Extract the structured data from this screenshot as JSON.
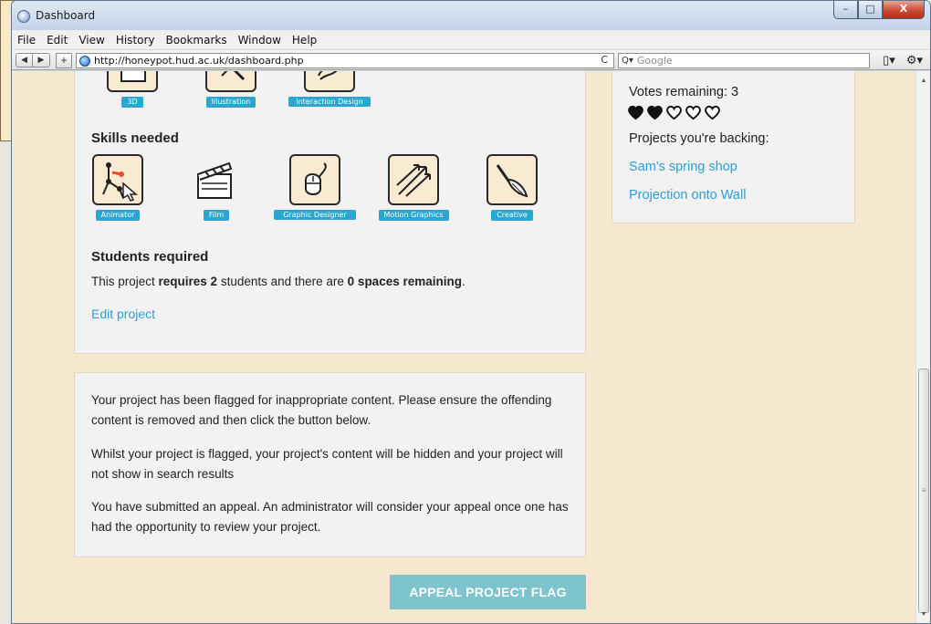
{
  "window": {
    "title": "Dashboard",
    "caption_buttons": {
      "minimize": "–",
      "maximize": "□",
      "close": "X"
    }
  },
  "menu": [
    "File",
    "Edit",
    "View",
    "History",
    "Bookmarks",
    "Window",
    "Help"
  ],
  "toolbar": {
    "back": "◀",
    "forward": "▶",
    "new_tab": "+",
    "url": "http://honeypot.hud.ac.uk/dashboard.php",
    "reload": "C",
    "search_prefix": "Q▾",
    "search_placeholder": "Google",
    "page_menu": "▯▾",
    "tools_menu": "⚙▾"
  },
  "categories": {
    "tiles": [
      {
        "label": "3D",
        "icon": "cube-icon"
      },
      {
        "label": "Illustration",
        "icon": "pencil-icon"
      },
      {
        "label": "Interaction Design",
        "icon": "interaction-icon"
      }
    ]
  },
  "skills": {
    "heading": "Skills needed",
    "tiles": [
      {
        "label": "Animator",
        "icon": "animator-icon"
      },
      {
        "label": "Film",
        "icon": "clapperboard-icon"
      },
      {
        "label": "Graphic Designer",
        "icon": "mouse-icon"
      },
      {
        "label": "Motion Graphics",
        "icon": "motion-arrows-icon"
      },
      {
        "label": "Creative",
        "icon": "paintbrush-icon"
      }
    ]
  },
  "students": {
    "heading": "Students required",
    "text_prefix": "This project ",
    "requires": "requires 2",
    "text_mid": " students and there are ",
    "spaces": "0 spaces remaining",
    "text_suffix": ".",
    "edit_link": "Edit project"
  },
  "flag_notice": {
    "para1": "Your project has been flagged for inappropriate content. Please ensure the offending content is removed and then click the button below.",
    "para2": "Whilst your project is flagged, your project's content will be hidden and your project will not show in search results",
    "para3": "You have submitted an appeal. An administrator will consider your appeal once one has had the opportunity to review your project."
  },
  "appeal_button": "APPEAL PROJECT FLAG",
  "sidebar": {
    "votes_remaining": "Votes remaining: 3",
    "votes_total": 5,
    "votes_used": 2,
    "backing_label": "Projects you're backing:",
    "projects": [
      "Sam's spring shop",
      "Projection onto Wall"
    ]
  },
  "colors": {
    "page_bg": "#f6e8cf",
    "panel_bg": "#f2f2f2",
    "badge": "#2aa6cf",
    "link": "#2a9fd6",
    "appeal_button": "#7ec4cf"
  }
}
